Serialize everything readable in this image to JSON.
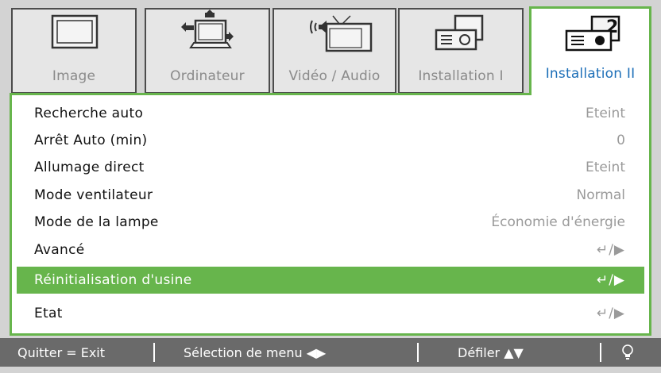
{
  "tabs": [
    {
      "label": "Image",
      "icon": "monitor-icon",
      "active": false
    },
    {
      "label": "Ordinateur",
      "icon": "computer-icon",
      "active": false
    },
    {
      "label": "Vidéo / Audio",
      "icon": "tv-audio-icon",
      "active": false
    },
    {
      "label": "Installation I",
      "icon": "projector-settings-icon",
      "active": false
    },
    {
      "label": "Installation II",
      "icon": "projector-settings-2-icon",
      "active": true
    }
  ],
  "menu": {
    "items": [
      {
        "name": "Recherche auto",
        "value": "Eteint"
      },
      {
        "name": "Arrêt Auto (min)",
        "value": "0"
      },
      {
        "name": "Allumage direct",
        "value": "Eteint"
      },
      {
        "name": "Mode ventilateur",
        "value": "Normal"
      },
      {
        "name": "Mode de la lampe",
        "value": "Économie d'énergie"
      },
      {
        "name": "Avancé",
        "value": "↵/▶"
      },
      {
        "name": "Réinitialisation d'usine",
        "value": "↵/▶",
        "selected": true
      },
      {
        "name": "Etat",
        "value": "↵/▶"
      }
    ]
  },
  "footer": {
    "exit": "Quitter = Exit",
    "select": "Sélection de menu ◀▶",
    "scroll": "Défiler ▲▼",
    "help_icon": "bulb-icon"
  },
  "colors": {
    "accent": "#67b54c",
    "active_label": "#1d6fb8",
    "footer_bg": "#6a6a6a"
  }
}
